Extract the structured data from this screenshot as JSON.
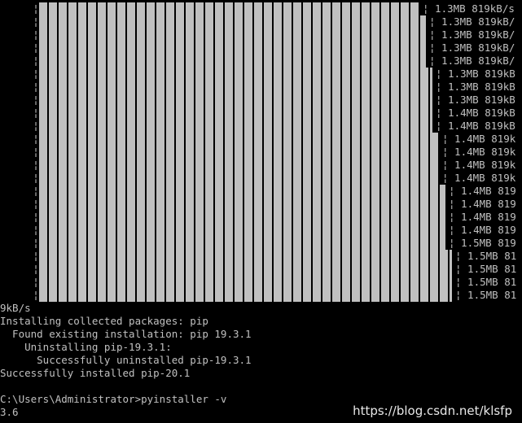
{
  "progress_rows": [
    {
      "pipe": "¦",
      "tail": "¦ 1.3MB 819kB/s"
    },
    {
      "pipe": "¦",
      "tail": "¦ 1.3MB 819kB/"
    },
    {
      "pipe": "¦",
      "tail": "¦ 1.3MB 819kB/"
    },
    {
      "pipe": "¦",
      "tail": "¦ 1.3MB 819kB/"
    },
    {
      "pipe": "¦",
      "tail": "¦ 1.3MB 819kB/"
    },
    {
      "pipe": "¦",
      "tail": "¦ 1.3MB 819kB"
    },
    {
      "pipe": "¦",
      "tail": "¦ 1.3MB 819kB"
    },
    {
      "pipe": "¦",
      "tail": "¦ 1.3MB 819kB"
    },
    {
      "pipe": "¦",
      "tail": "¦ 1.4MB 819kB"
    },
    {
      "pipe": "¦",
      "tail": "¦ 1.4MB 819kB"
    },
    {
      "pipe": "¦",
      "tail": "¦ 1.4MB 819k"
    },
    {
      "pipe": "¦",
      "tail": "¦ 1.4MB 819k"
    },
    {
      "pipe": "¦",
      "tail": "¦ 1.4MB 819k"
    },
    {
      "pipe": "¦",
      "tail": "¦ 1.4MB 819k"
    },
    {
      "pipe": "¦",
      "tail": "¦ 1.4MB 819"
    },
    {
      "pipe": "¦",
      "tail": "¦ 1.4MB 819"
    },
    {
      "pipe": "¦",
      "tail": "¦ 1.4MB 819"
    },
    {
      "pipe": "¦",
      "tail": "¦ 1.4MB 819"
    },
    {
      "pipe": "¦",
      "tail": "¦ 1.5MB 819"
    },
    {
      "pipe": "¦",
      "tail": "¦ 1.5MB 81"
    },
    {
      "pipe": "¦",
      "tail": "¦ 1.5MB 81"
    },
    {
      "pipe": "¦",
      "tail": "¦ 1.5MB 81"
    },
    {
      "pipe": "¦",
      "tail": "¦ 1.5MB 81"
    }
  ],
  "output_lines": [
    "9kB/s",
    "Installing collected packages: pip",
    "  Found existing installation: pip 19.3.1",
    "    Uninstalling pip-19.3.1:",
    "      Successfully uninstalled pip-19.3.1",
    "Successfully installed pip-20.1",
    "",
    "C:\\Users\\Administrator>pyinstaller -v",
    "3.6"
  ],
  "watermark": "https://blog.csdn.net/klsfp",
  "colors": {
    "background": "#000000",
    "text": "#c0c0c0",
    "bar": "#c0c0c0"
  }
}
